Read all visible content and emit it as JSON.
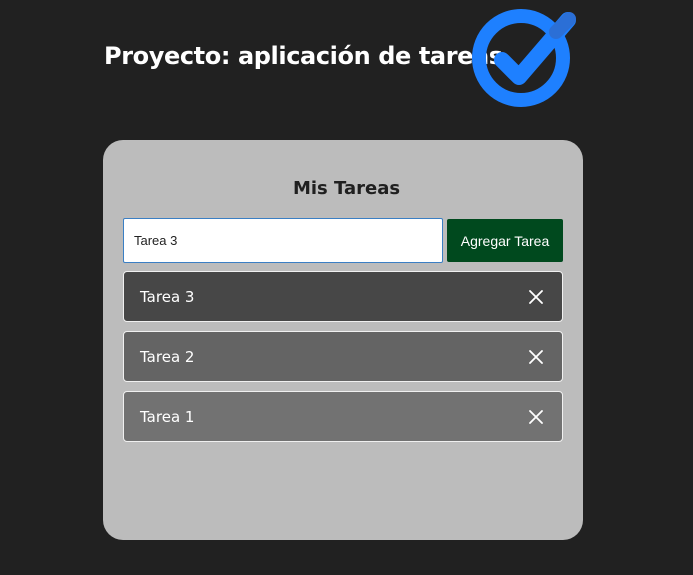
{
  "header": {
    "title": "Proyecto: aplicación de tareas",
    "logo_icon": "check-circle-icon",
    "logo_color": "#1e80ff"
  },
  "card": {
    "title": "Mis Tareas",
    "input": {
      "value": "Tarea 3",
      "placeholder": ""
    },
    "add_button_label": "Agregar Tarea",
    "tasks": [
      {
        "text": "Tarea 3",
        "close_icon": "close-icon"
      },
      {
        "text": "Tarea 2",
        "close_icon": "close-icon"
      },
      {
        "text": "Tarea 1",
        "close_icon": "close-icon"
      }
    ]
  },
  "colors": {
    "background": "#212121",
    "card": "#bcbcbc",
    "button": "#00491e",
    "accent": "#1e80ff"
  }
}
